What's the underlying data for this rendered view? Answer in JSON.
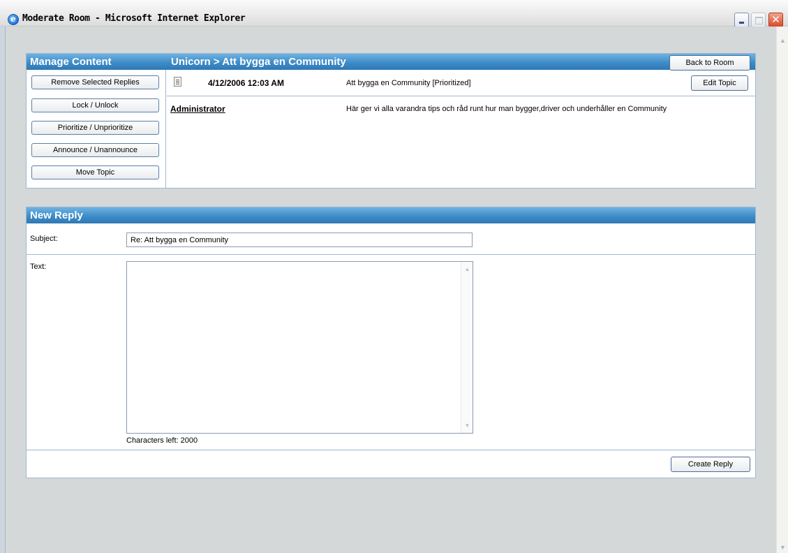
{
  "window": {
    "title": "Moderate Room - Microsoft Internet Explorer",
    "icon": "ie-icon",
    "controls": [
      "minimize-icon",
      "maximize-icon",
      "close-icon"
    ],
    "close_glyph": "✕"
  },
  "manage": {
    "header": "Manage Content",
    "actions": [
      "Remove Selected Replies",
      "Lock / Unlock",
      "Prioritize / Unprioritize",
      "Announce / Unannounce",
      "Move Topic"
    ]
  },
  "topic": {
    "breadcrumb": "Unicorn > Att bygga en Community",
    "back_label": "Back to Room",
    "date": "4/12/2006 12:03 AM",
    "subject": "Att bygga en Community [Prioritized]",
    "edit_label": "Edit Topic",
    "author": "Administrator",
    "body": "Här ger vi alla varandra tips och råd runt hur man bygger,driver och underhåller en Community"
  },
  "reply": {
    "header": "New Reply",
    "subject_label": "Subject:",
    "subject_value": "Re: Att bygga en Community",
    "text_label": "Text:",
    "text_value": "",
    "chars_left": "Characters left: 2000",
    "create_label": "Create Reply"
  },
  "colors": {
    "header_blue": "#3e8cc8",
    "border_blue": "#9fb8d2",
    "background": "#d4d8d8"
  }
}
